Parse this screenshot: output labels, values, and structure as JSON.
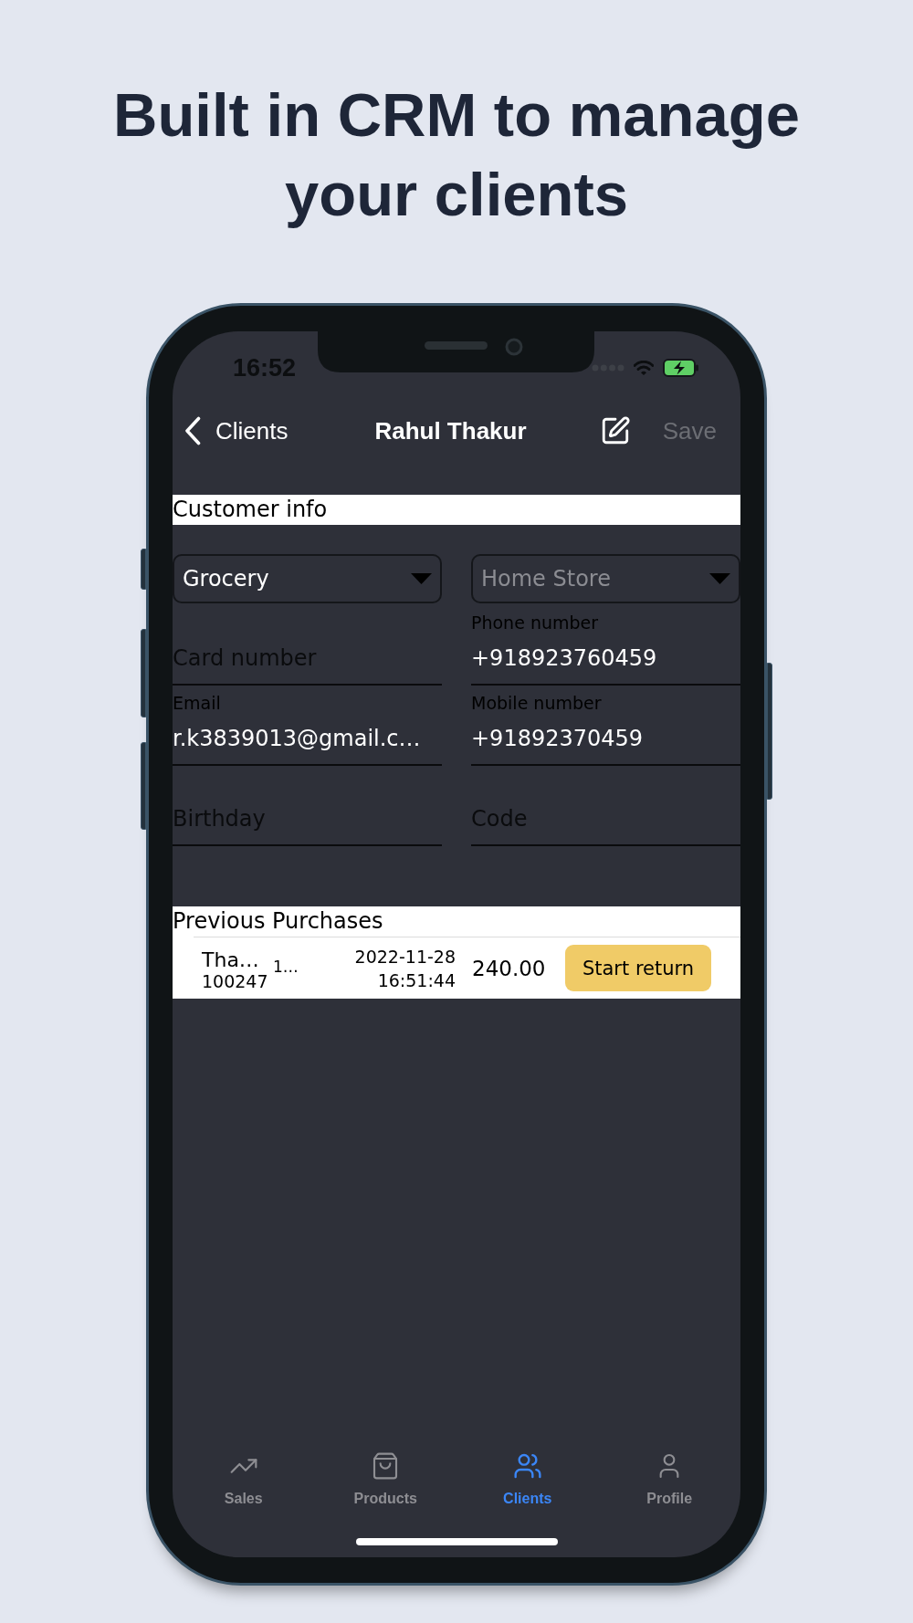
{
  "headline": "Built in CRM to manage your clients",
  "status_bar": {
    "time": "16:52"
  },
  "nav_bar": {
    "back_label": "Clients",
    "title": "Rahul Thakur",
    "save_label": "Save",
    "save_disabled": true
  },
  "customer_info": {
    "title": "Customer info",
    "dropdowns": [
      {
        "value": "Grocery"
      },
      {
        "placeholder": "Home Store"
      }
    ],
    "fields": [
      {
        "placeholder": "Card number"
      },
      {
        "label": "Email",
        "value": "r.k3839013@gmail.c…"
      },
      {
        "placeholder": "Birthday"
      },
      {
        "label": "Phone number",
        "value": "+918923760459"
      },
      {
        "label": "Mobile number",
        "value": "+91892370459"
      },
      {
        "placeholder": "Code"
      }
    ]
  },
  "previous_purchases": {
    "title": "Previous Purchases",
    "rows": [
      {
        "name": "Tha…",
        "number": "100247",
        "column_3": "1…",
        "date": "2022-11-28",
        "time": "16:51:44",
        "amount": "240.00",
        "action": "Start return"
      }
    ]
  },
  "tab_bar": [
    {
      "label": "Sales",
      "selected": false
    },
    {
      "label": "Products",
      "selected": false
    },
    {
      "label": "Clients",
      "selected": true
    },
    {
      "label": "Profile",
      "selected": false
    }
  ]
}
